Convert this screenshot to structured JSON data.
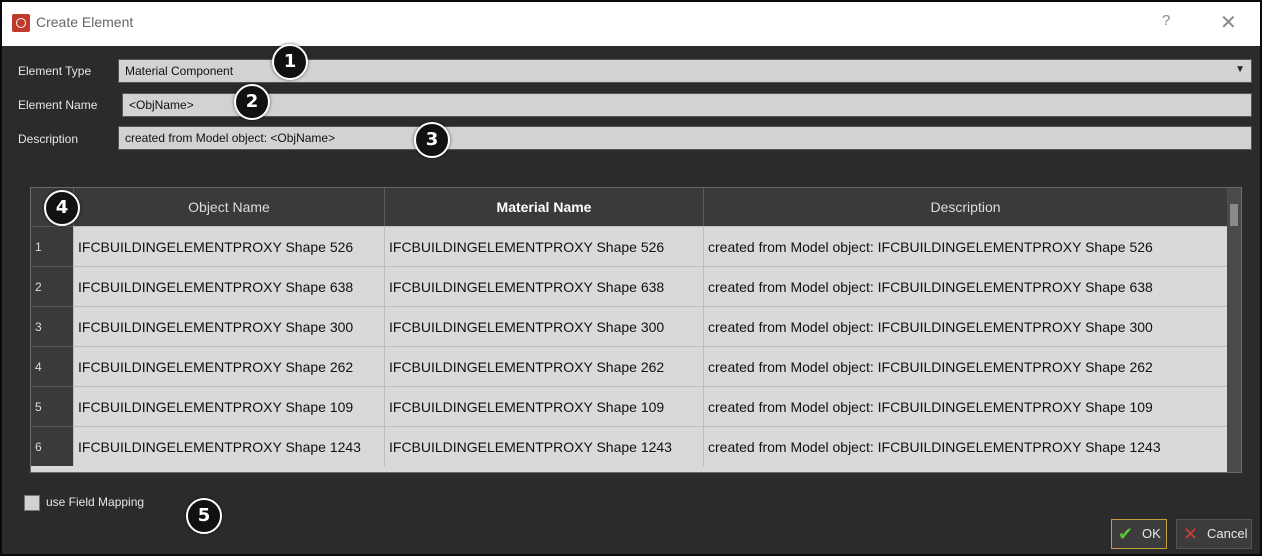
{
  "window": {
    "title": "Create Element",
    "help_glyph": "?",
    "close_glyph": "✕"
  },
  "form": {
    "element_type": {
      "label": "Element Type",
      "value": "Material Component"
    },
    "element_name": {
      "label": "Element Name",
      "value": "<ObjName>"
    },
    "description": {
      "label": "Description",
      "value": "created from Model object: <ObjName>"
    }
  },
  "badges": [
    "1",
    "2",
    "3",
    "4",
    "5"
  ],
  "table": {
    "columns": [
      "Object Name",
      "Material Name",
      "Description"
    ],
    "rows": [
      {
        "n": "1",
        "object": "IFCBUILDINGELEMENTPROXY Shape 526",
        "material": "IFCBUILDINGELEMENTPROXY Shape 526",
        "desc": "created from Model object: IFCBUILDINGELEMENTPROXY Shape 526"
      },
      {
        "n": "2",
        "object": "IFCBUILDINGELEMENTPROXY Shape 638",
        "material": "IFCBUILDINGELEMENTPROXY Shape 638",
        "desc": "created from Model object: IFCBUILDINGELEMENTPROXY Shape 638"
      },
      {
        "n": "3",
        "object": "IFCBUILDINGELEMENTPROXY Shape 300",
        "material": "IFCBUILDINGELEMENTPROXY Shape 300",
        "desc": "created from Model object: IFCBUILDINGELEMENTPROXY Shape 300"
      },
      {
        "n": "4",
        "object": "IFCBUILDINGELEMENTPROXY Shape 262",
        "material": "IFCBUILDINGELEMENTPROXY Shape 262",
        "desc": "created from Model object: IFCBUILDINGELEMENTPROXY Shape 262"
      },
      {
        "n": "5",
        "object": "IFCBUILDINGELEMENTPROXY Shape 109",
        "material": "IFCBUILDINGELEMENTPROXY Shape 109",
        "desc": "created from Model object: IFCBUILDINGELEMENTPROXY Shape 109"
      },
      {
        "n": "6",
        "object": "IFCBUILDINGELEMENTPROXY Shape 1243",
        "material": "IFCBUILDINGELEMENTPROXY Shape 1243",
        "desc": "created from Model object: IFCBUILDINGELEMENTPROXY Shape 1243"
      }
    ]
  },
  "options": {
    "field_mapping_label": "use Field Mapping",
    "field_mapping_checked": false
  },
  "buttons": {
    "ok": "OK",
    "cancel": "Cancel"
  },
  "icons": {
    "app": "app-logo-icon",
    "ok": "checkmark-icon",
    "cancel": "x-icon"
  },
  "colors": {
    "ok_check": "#5bc236",
    "cancel_x": "#d23b3b"
  }
}
